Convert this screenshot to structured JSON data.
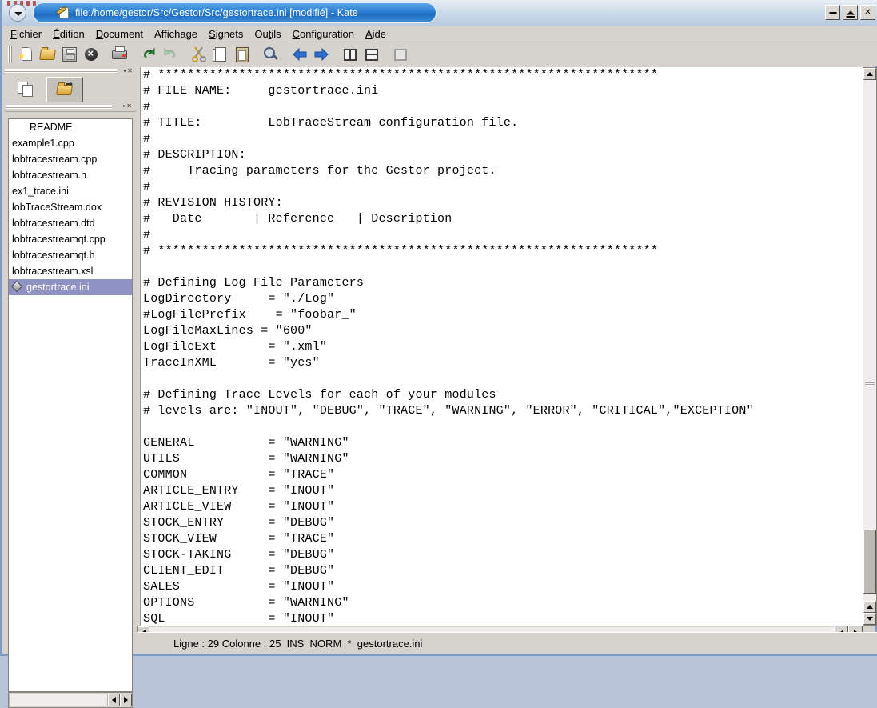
{
  "window": {
    "title": "file:/home/gestor/Src/Gestor/Src/gestortrace.ini [modifié] - Kate",
    "title_icon": "document-pencil-icon",
    "minimize_label": "_",
    "maximize_label": "▲",
    "close_label": "×"
  },
  "menubar": {
    "items": [
      {
        "name": "menu-fichier",
        "pre": "F",
        "rest": "ichier"
      },
      {
        "name": "menu-edition",
        "pre": "É",
        "rest": "dition"
      },
      {
        "name": "menu-document",
        "pre": "D",
        "rest": "ocument"
      },
      {
        "name": "menu-affichage",
        "pre": "Afficha",
        "mid": "g",
        "rest": "e"
      },
      {
        "name": "menu-signets",
        "pre": "S",
        "rest": "ignets"
      },
      {
        "name": "menu-outils",
        "pre": "Ou",
        "mid": "t",
        "rest": "ils"
      },
      {
        "name": "menu-configuration",
        "pre": "C",
        "rest": "onfiguration"
      },
      {
        "name": "menu-aide",
        "pre": "A",
        "rest": "ide"
      }
    ]
  },
  "toolbar": {
    "buttons": [
      "new-file-icon",
      "open-file-icon",
      "save-file-icon",
      "close-file-icon",
      "print-icon",
      "undo-icon",
      "redo-icon",
      "cut-icon",
      "copy-icon",
      "paste-icon",
      "find-icon",
      "back-icon",
      "forward-icon",
      "split-vertical-icon",
      "split-horizontal-icon",
      "close-view-icon"
    ]
  },
  "sidebar": {
    "tabs": [
      {
        "name": "tab-documents",
        "icon": "documents-icon",
        "active": false
      },
      {
        "name": "tab-filesystem",
        "icon": "folder-open-icon",
        "active": true
      }
    ],
    "files": [
      {
        "label": "README",
        "selected": false
      },
      {
        "label": "example1.cpp",
        "selected": false
      },
      {
        "label": "lobtracestream.cpp",
        "selected": false
      },
      {
        "label": "lobtracestream.h",
        "selected": false
      },
      {
        "label": "ex1_trace.ini",
        "selected": false
      },
      {
        "label": "lobTraceStream.dox",
        "selected": false
      },
      {
        "label": "lobtracestream.dtd",
        "selected": false
      },
      {
        "label": "lobtracestreamqt.cpp",
        "selected": false
      },
      {
        "label": "lobtracestreamqt.h",
        "selected": false
      },
      {
        "label": "lobtracestream.xsl",
        "selected": false
      },
      {
        "label": "gestortrace.ini",
        "selected": true
      }
    ]
  },
  "editor": {
    "lines": [
      "# ********************************************************************",
      "# FILE NAME:     gestortrace.ini",
      "#",
      "# TITLE:         LobTraceStream configuration file.",
      "#",
      "# DESCRIPTION:",
      "#     Tracing parameters for the Gestor project.",
      "#",
      "# REVISION HISTORY:",
      "#   Date       | Reference   | Description",
      "#",
      "# ********************************************************************",
      "",
      "# Defining Log File Parameters",
      "LogDirectory     = \"./Log\"",
      "#LogFilePrefix    = \"foobar_\"",
      "LogFileMaxLines = \"600\"",
      "LogFileExt       = \".xml\"",
      "TraceInXML       = \"yes\"",
      "",
      "# Defining Trace Levels for each of your modules",
      "# levels are: \"INOUT\", \"DEBUG\", \"TRACE\", \"WARNING\", \"ERROR\", \"CRITICAL\",\"EXCEPTION\"",
      "",
      "GENERAL          = \"WARNING\"",
      "UTILS            = \"WARNING\"",
      "COMMON           = \"TRACE\"",
      "ARTICLE_ENTRY    = \"INOUT\"",
      "ARTICLE_VIEW     = \"INOUT\"",
      "STOCK_ENTRY      = \"DEBUG\"",
      "STOCK_VIEW       = \"TRACE\"",
      "STOCK-TAKING     = \"DEBUG\"",
      "CLIENT_EDIT      = \"DEBUG\"",
      "SALES            = \"INOUT\"",
      "OPTIONS          = \"WARNING\"",
      "SQL              = \"INOUT\""
    ]
  },
  "statusbar": {
    "text": "Ligne : 29 Colonne : 25  INS  NORM  *  gestortrace.ini"
  },
  "colors": {
    "titlebar_blue": "#2a7fd4",
    "window_chrome": "#d6d2cd",
    "selection": "#8f93c4",
    "editor_bg": "#ffffff"
  }
}
